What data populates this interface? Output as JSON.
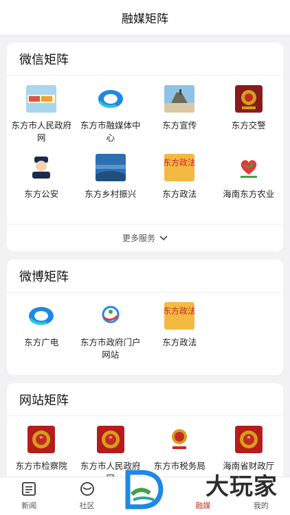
{
  "header": {
    "title": "融媒矩阵"
  },
  "wechat": {
    "title": "微信矩阵",
    "items": [
      {
        "label": "东方市人民政府网",
        "icon": "gov-banner-icon"
      },
      {
        "label": "东方市融媒体中心",
        "icon": "media-center-logo-icon"
      },
      {
        "label": "东方宣传",
        "icon": "coast-landscape-icon"
      },
      {
        "label": "东方交警",
        "icon": "traffic-police-badge-icon"
      },
      {
        "label": "东方公安",
        "icon": "police-cartoon-icon"
      },
      {
        "label": "东方乡村振兴",
        "icon": "rural-revitalization-banner-icon"
      },
      {
        "label": "东方政法",
        "icon": "politics-law-icon",
        "badge": "东方政法"
      },
      {
        "label": "海南东方农业",
        "icon": "agriculture-heart-icon"
      }
    ],
    "more_label": "更多服务"
  },
  "weibo": {
    "title": "微博矩阵",
    "items": [
      {
        "label": "东方广电",
        "icon": "broadcast-logo-icon"
      },
      {
        "label": "东方市政府门户网站",
        "icon": "gov-portal-logo-icon"
      },
      {
        "label": "东方政法",
        "icon": "politics-law-icon",
        "badge": "东方政法"
      }
    ]
  },
  "website": {
    "title": "网站矩阵",
    "items": [
      {
        "label": "东方市检察院",
        "icon": "national-emblem-icon"
      },
      {
        "label": "东方市人民政府网",
        "icon": "national-emblem-icon"
      },
      {
        "label": "东方市税务局",
        "icon": "tax-bureau-emblem-icon"
      },
      {
        "label": "海南省财政厅",
        "icon": "national-emblem-icon"
      }
    ]
  },
  "tabbar": {
    "items": [
      {
        "label": "新闻",
        "icon": "newspaper-icon"
      },
      {
        "label": "社区",
        "icon": "community-icon"
      },
      {
        "label": "融媒",
        "icon": "matrix-icon",
        "active": true
      },
      {
        "label": "我的",
        "icon": "profile-icon"
      }
    ]
  },
  "watermark": "大玩家",
  "colors": {
    "accent": "#c0392b",
    "background": "#f2f2f5"
  }
}
